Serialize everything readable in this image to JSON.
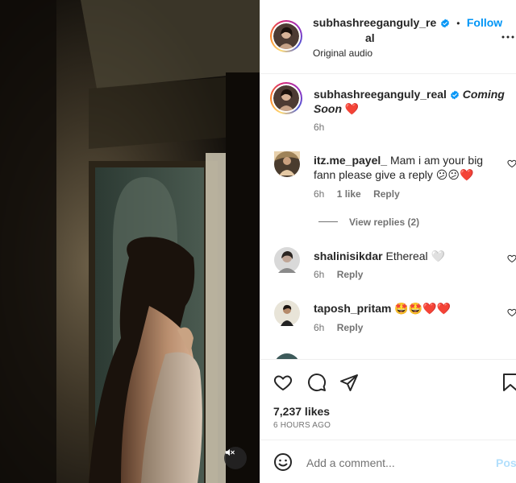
{
  "post": {
    "author": "subhashreeganguly_real",
    "author_line1": "subhashreeganguly_re",
    "author_line2": "al",
    "follow_label": "Follow",
    "dot": "•",
    "audio": "Original audio",
    "more_icon": "more-options-icon"
  },
  "caption": {
    "username": "subhashreeganguly_real",
    "text_line1": "Coming",
    "text_line2": "Soon",
    "emoji": "❤️",
    "time": "6h"
  },
  "comments": [
    {
      "username": "itz.me_payel_",
      "text_line1": "Mam i am your big",
      "text_line2": "fann please give a reply",
      "emojis": "😕😕❤️",
      "time": "6h",
      "likes": "1 like",
      "reply": "Reply",
      "view_replies": "View replies (2)"
    },
    {
      "username": "shalinisikdar",
      "text": "Ethereal",
      "emoji": "🤍",
      "time": "6h",
      "reply": "Reply"
    },
    {
      "username": "taposh_pritam",
      "emojis": "🤩🤩❤️❤️",
      "time": "6h",
      "reply": "Reply"
    }
  ],
  "stats": {
    "likes": "7,237 likes",
    "ago": "6 HOURS AGO"
  },
  "composer": {
    "placeholder": "Add a comment...",
    "post_label": "Post"
  },
  "colors": {
    "accent": "#0095f6",
    "verified": "#0095f6",
    "heart": "#ed4956",
    "post_disabled": "#b2dffc"
  }
}
